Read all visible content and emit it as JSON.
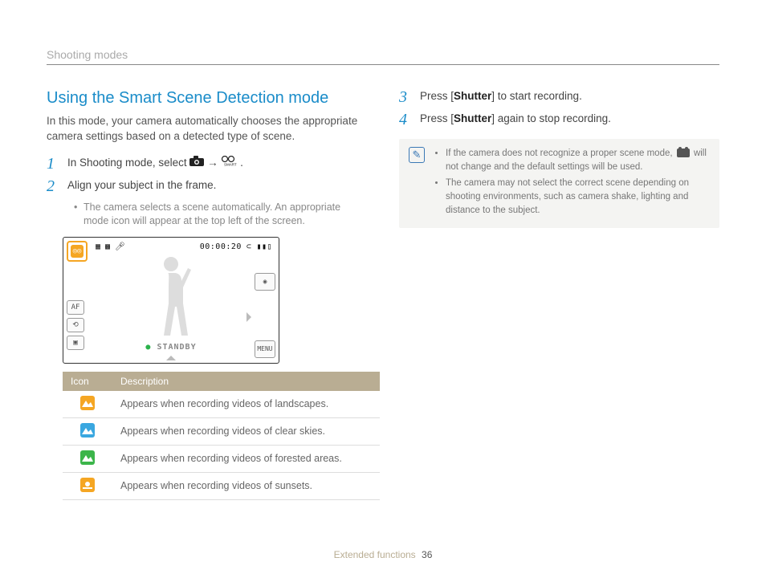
{
  "breadcrumb": "Shooting modes",
  "title": "Using the Smart Scene Detection mode",
  "intro": "In this mode, your camera automatically chooses the appropriate camera settings based on a detected type of scene.",
  "steps_left": {
    "s1_pre": "In Shooting mode, select ",
    "s1_arrow": " → ",
    "s1_post": ".",
    "s2": "Align your subject in the frame.",
    "s2_sub": "The camera selects a scene automatically. An appropriate mode icon will appear at the top left of the screen."
  },
  "cam": {
    "time": "00:00:20",
    "standby": "STANDBY",
    "menu": "MENU",
    "af": "AF"
  },
  "table": {
    "h1": "Icon",
    "h2": "Description",
    "rows": [
      {
        "desc": "Appears when recording videos of landscapes."
      },
      {
        "desc": "Appears when recording videos of clear skies."
      },
      {
        "desc": "Appears when recording videos of forested areas."
      },
      {
        "desc": "Appears when recording videos of sunsets."
      }
    ]
  },
  "steps_right": {
    "s3_pre": "Press [",
    "s3_b": "Shutter",
    "s3_post": "] to start recording.",
    "s4_pre": "Press [",
    "s4_b": "Shutter",
    "s4_post": "] again to stop recording."
  },
  "notes": {
    "n1a": "If the camera does not recognize a proper scene mode, ",
    "n1b": " will not change and the default settings will be used.",
    "n2": "The camera may not select the correct scene depending on shooting environments, such as camera shake, lighting and distance to the subject."
  },
  "footer": {
    "section": "Extended functions",
    "page": "36"
  }
}
